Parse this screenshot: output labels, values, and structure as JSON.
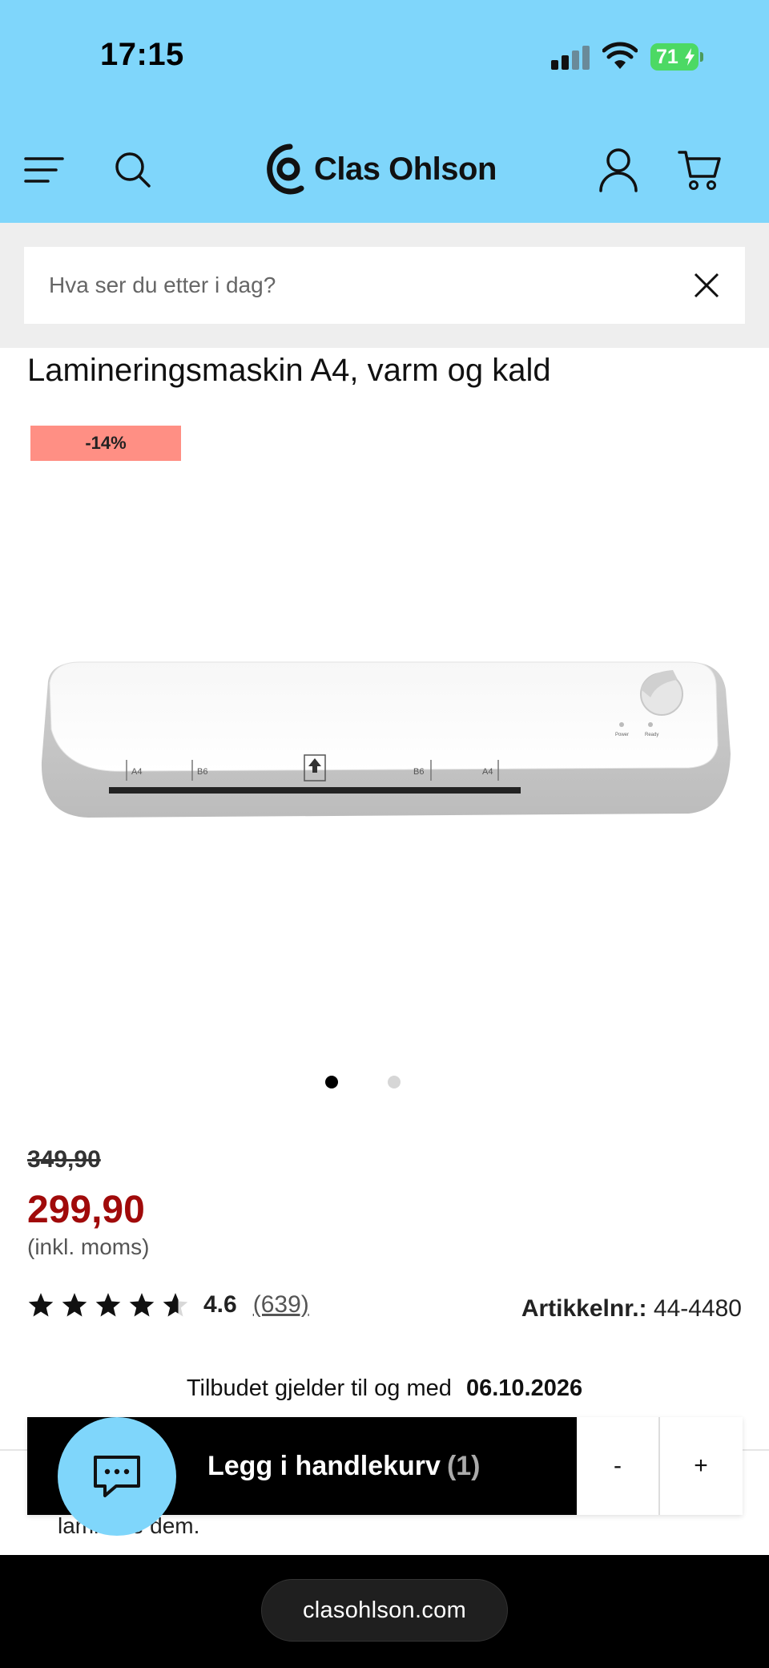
{
  "status": {
    "time": "17:15",
    "battery": "71"
  },
  "header": {
    "brand": "Clas Ohlson"
  },
  "search": {
    "placeholder": "Hva ser du etter i dag?"
  },
  "product": {
    "title": "Lamineringsmaskin A4, varm og kald",
    "discount_badge": "-14%",
    "image_dots": {
      "count": 2,
      "active": 1
    },
    "old_price": "349,90",
    "price": "299,90",
    "vat_note": "(inkl. moms)",
    "rating": {
      "score": "4.6",
      "count": "(639)",
      "stars": 4.6
    },
    "article_label": "Artikkelnr.:",
    "article_number": "44-4480",
    "offer_text": "Tilbudet gjelder til og med",
    "offer_date": "06.10.2026",
    "image_labels": [
      "A4",
      "B6",
      "B6",
      "A4"
    ],
    "knob_labels": [
      "Power",
      "Ready"
    ]
  },
  "cart": {
    "label": "Legg i handlekurv",
    "count": "(1)",
    "minus": "-",
    "plus": "+"
  },
  "peek_text": "laminere dem.",
  "browser": {
    "url": "clasohlson.com"
  },
  "colors": {
    "header_bg": "#7fd6fb",
    "price_red": "#a00a0a",
    "discount_bg": "#ff8f84",
    "battery_green": "#4cd964"
  }
}
